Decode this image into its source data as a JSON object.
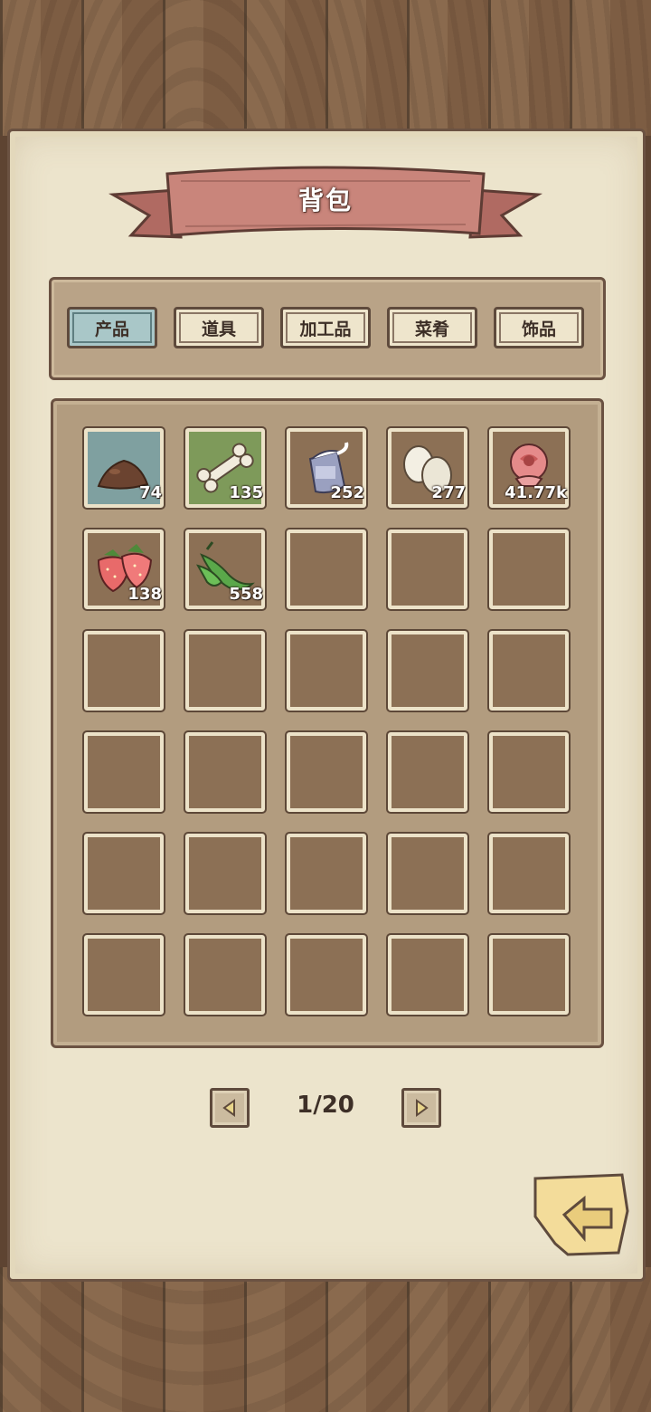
{
  "title": "背包",
  "tabs": [
    {
      "label": "产品",
      "active": true
    },
    {
      "label": "道具",
      "active": false
    },
    {
      "label": "加工品",
      "active": false
    },
    {
      "label": "菜肴",
      "active": false
    },
    {
      "label": "饰品",
      "active": false
    }
  ],
  "inventory": {
    "items": [
      {
        "icon": "dirt-pile-icon",
        "count": "74"
      },
      {
        "icon": "bone-icon",
        "count": "135"
      },
      {
        "icon": "milk-jug-icon",
        "count": "252"
      },
      {
        "icon": "eggs-icon",
        "count": "277"
      },
      {
        "icon": "rose-icon",
        "count": "41.77k"
      },
      {
        "icon": "strawberry-icon",
        "count": "138"
      },
      {
        "icon": "green-pepper-icon",
        "count": "558"
      }
    ],
    "total_slots": 30
  },
  "pagination": {
    "label": "1/20"
  },
  "colors": {
    "active_tab": "#a9c7c8",
    "banner": "#c9857b",
    "parchment": "#ece4cc",
    "slot": "#8c7055"
  }
}
